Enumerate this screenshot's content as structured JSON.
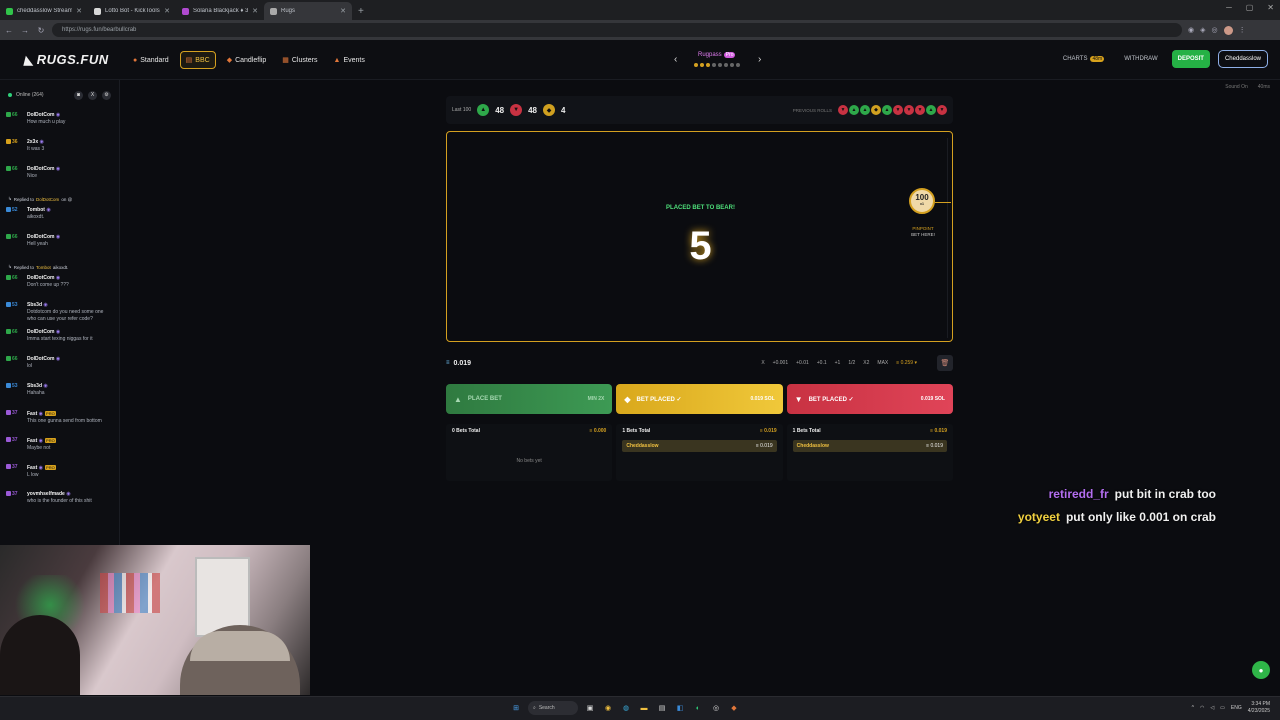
{
  "browser": {
    "tabs": [
      {
        "title": "cheddasslow Stream - Watch Liv",
        "color": "#31c44a",
        "active": false
      },
      {
        "title": "Lotto Bot - KickTools",
        "color": "#d8d8d8",
        "active": false
      },
      {
        "title": "Solana Blackjack ♦ 3:2 SOL Payou",
        "color": "#b04ad0",
        "active": false
      },
      {
        "title": "Rugs",
        "color": "#aaaaaa",
        "active": true
      }
    ],
    "new_tab": "+",
    "url": "https://rugs.fun/bearbullcrab"
  },
  "header": {
    "logo": "RUGS.FUN",
    "nav": [
      {
        "label": "Standard",
        "icon": "flame-icon",
        "glyph": "●",
        "active": false
      },
      {
        "label": "BBC",
        "icon": "chart-icon",
        "glyph": "▤",
        "active": true
      },
      {
        "label": "Candleflip",
        "icon": "candle-icon",
        "glyph": "◆",
        "active": false
      },
      {
        "label": "Clusters",
        "icon": "grid-icon",
        "glyph": "▦",
        "active": false
      },
      {
        "label": "Events",
        "icon": "trophy-icon",
        "glyph": "▲",
        "active": false
      }
    ],
    "center_game": {
      "title": "Rugpass",
      "badge": "Pro"
    },
    "charts_label": "CHARTS",
    "charts_badge": "48m",
    "withdraw_label": "WITHDRAW",
    "deposit_label": "DEPOSIT",
    "user_label": "Cheddasslow",
    "sound_label": "Sound On",
    "latency_label": "40ms"
  },
  "chat": {
    "online_label": "Online (264)",
    "messages": [
      {
        "kind": "msg",
        "level": "66",
        "lvl_color": "#2ea84a",
        "user": "DolDotCom",
        "text": "How much u play"
      },
      {
        "kind": "msg",
        "level": "36",
        "lvl_color": "#d8a21c",
        "user": "2x3x",
        "text": "It was 3"
      },
      {
        "kind": "msg",
        "level": "66",
        "lvl_color": "#2ea84a",
        "user": "DolDotCom",
        "text": "Nice"
      },
      {
        "kind": "reply",
        "prefix": "Replied to",
        "to": "DolDotCom",
        "suffix": "on @"
      },
      {
        "kind": "msg",
        "level": "52",
        "lvl_color": "#3a8ad8",
        "user": "Tombot",
        "text": "aikoxdt."
      },
      {
        "kind": "msg",
        "level": "66",
        "lvl_color": "#2ea84a",
        "user": "DolDotCom",
        "text": "Hell yeah"
      },
      {
        "kind": "reply",
        "prefix": "Replied to",
        "to": "Tombot",
        "suffix": "aikoxdt."
      },
      {
        "kind": "msg",
        "level": "66",
        "lvl_color": "#2ea84a",
        "user": "DolDotCom",
        "text": "Don't come up ???"
      },
      {
        "kind": "msg",
        "level": "53",
        "lvl_color": "#3a8ad8",
        "user": "Sbs3d",
        "text": "Dotdotcom do you need some one who can use your refer code?"
      },
      {
        "kind": "msg",
        "level": "66",
        "lvl_color": "#2ea84a",
        "user": "DolDotCom",
        "text": "Imma start texing niggas for it"
      },
      {
        "kind": "msg",
        "level": "66",
        "lvl_color": "#2ea84a",
        "user": "DolDotCom",
        "text": "lol"
      },
      {
        "kind": "msg",
        "level": "53",
        "lvl_color": "#3a8ad8",
        "user": "Sbs3d",
        "text": "Hahaha"
      },
      {
        "kind": "msg",
        "level": "37",
        "lvl_color": "#9b5ad8",
        "user": "Fast",
        "text": "This one gunna send from bottom",
        "pro": "PRO"
      },
      {
        "kind": "msg",
        "level": "37",
        "lvl_color": "#9b5ad8",
        "user": "Fast",
        "text": "Maybe not",
        "pro": "PRO"
      },
      {
        "kind": "msg",
        "level": "37",
        "lvl_color": "#9b5ad8",
        "user": "Fast",
        "text": "L low",
        "pro": "PRO"
      },
      {
        "kind": "msg",
        "level": "37",
        "lvl_color": "#9b5ad8",
        "user": "yovmhselfmade",
        "text": "who is the founder of this shit"
      }
    ]
  },
  "game": {
    "last_label": "Last 100",
    "bull_count": "48",
    "bear_count": "48",
    "crab_count": "4",
    "previous_label": "PREVIOUS ROLLS",
    "previous_rolls": [
      "bear",
      "bull",
      "bull",
      "crab",
      "bull",
      "bear",
      "bear",
      "bear",
      "bull",
      "bear"
    ],
    "stage_note": "PLACED BET TO BEAR!",
    "countdown": "5",
    "marker_value": "100",
    "marker_sub": "x1",
    "marker_label_1": "PINPOINT",
    "marker_label_2": "BET HERE!",
    "bet_amount": "0.019",
    "quick": [
      "X",
      "+0.001",
      "+0.01",
      "+0.1",
      "+1",
      "1/2",
      "X2",
      "MAX"
    ],
    "balance": "0.259",
    "buttons": {
      "bull": {
        "label": "PLACE BET",
        "value": "MIN 2X"
      },
      "crab": {
        "label": "BET PLACED ✓",
        "value": "0.019 SOL"
      },
      "bear": {
        "label": "BET PLACED ✓",
        "value": "0.019 SOL"
      }
    },
    "columns": [
      {
        "header": "0 Bets Total",
        "total": "0.000",
        "empty": "No bets yet",
        "entries": []
      },
      {
        "header": "1 Bets Total",
        "total": "0.019",
        "entries": [
          {
            "name": "Cheddasslow",
            "value": "0.019"
          }
        ]
      },
      {
        "header": "1 Bets Total",
        "total": "0.019",
        "entries": [
          {
            "name": "Cheddasslow",
            "value": "0.019"
          }
        ]
      }
    ]
  },
  "overlay": [
    {
      "user": "retiredd_fr",
      "color": "#b36ef0",
      "text": "put bit in crab too"
    },
    {
      "user": "yotyeet",
      "color": "#f0d040",
      "text": "put only like 0.001 on crab"
    }
  ],
  "taskbar": {
    "search_label": "Search",
    "time": "3:34 PM",
    "date": "4/23/2025",
    "lang": "ENG"
  }
}
